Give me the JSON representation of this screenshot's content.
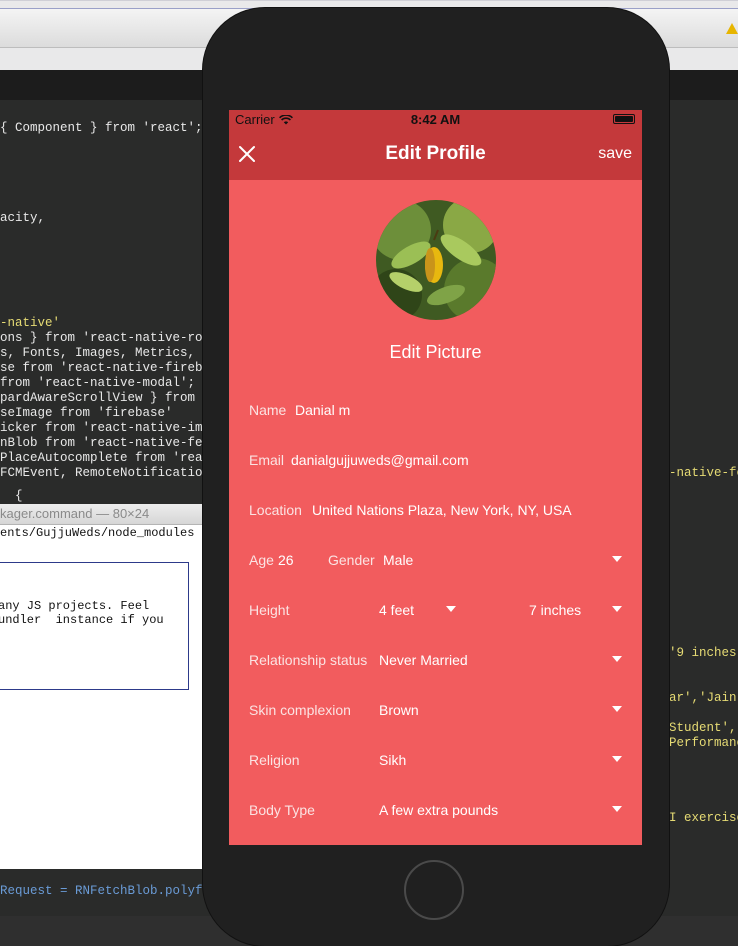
{
  "background": {
    "code_lines": [
      "{ Component } from 'react';",
      "acity,",
      "-native'",
      "ons } from 'react-native-route",
      "s, Fonts, Images, Metrics, Sty",
      "se from 'react-native-firebase",
      "from 'react-native-modal';",
      "pardAwareScrollView } from 're",
      "seImage from 'firebase'",
      "icker from 'react-native-image",
      "nBlob from 'react-native-fetch",
      "PlaceAutocomplete from 'react-",
      "FCMEvent, RemoteNotificationRe",
      "  {"
    ],
    "right_code_lines": [
      "-native-fc",
      "'9 inches'",
      "ar','Jain",
      "Student',",
      "Performanc",
      "I exercise"
    ],
    "terminal_title": "kager.command — 80×24",
    "terminal_path": "ents/GujjuWeds/node_modules (",
    "terminal_text": "any JS projects. Feel\nundler  instance if you",
    "bottom_code": "Request = RNFetchBlob.polyfill"
  },
  "status_bar": {
    "carrier": "Carrier",
    "time": "8:42 AM"
  },
  "nav": {
    "title": "Edit Profile",
    "save": "save"
  },
  "profile": {
    "edit_picture": "Edit Picture",
    "name_label": "Name",
    "name_value": "Danial m",
    "email_label": "Email",
    "email_value": "danialgujjuweds@gmail.com",
    "location_label": "Location",
    "location_value": "United Nations Plaza, New York, NY, USA",
    "age_label": "Age",
    "age_value": "26",
    "gender_label": "Gender",
    "gender_value": "Male",
    "height_label": "Height",
    "height_feet": "4 feet",
    "height_inches": "7 inches",
    "relationship_label": "Relationship status",
    "relationship_value": "Never Married",
    "skin_label": "Skin complexion",
    "skin_value": "Brown",
    "religion_label": "Religion",
    "religion_value": "Sikh",
    "body_label": "Body Type",
    "body_value": "A few extra pounds"
  },
  "colors": {
    "screen_bg": "#f25c5e",
    "navbar_bg": "#c4393b"
  }
}
